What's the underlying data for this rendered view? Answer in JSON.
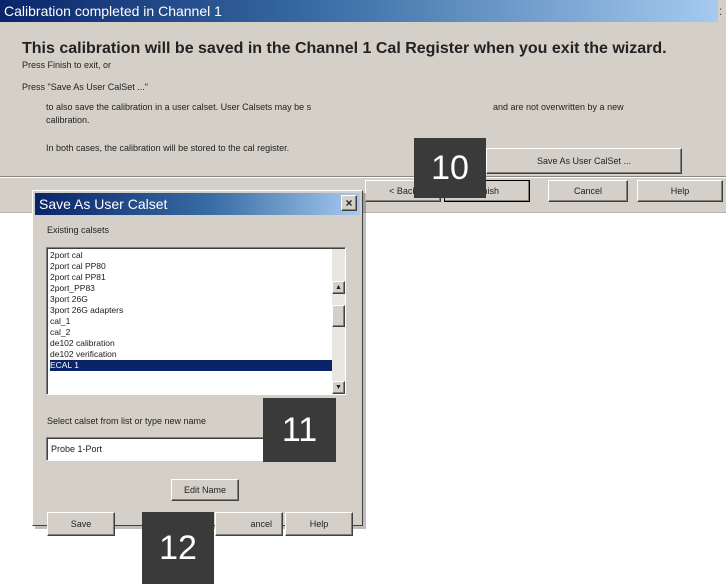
{
  "wizard": {
    "title": "Calibration completed in Channel 1",
    "headline": "This calibration will be saved in the Channel 1 Cal Register when you exit the wizard.",
    "line_finish": "Press Finish to exit, or",
    "line_saveas": "Press \"Save As User CalSet ...\"",
    "para_1a": "to also save the calibration in a user calset. User Calsets may be s",
    "para_1b": "and are not overwritten by a new",
    "para_1c": "calibration.",
    "para_2": "In both cases, the calibration will be stored to the cal register.",
    "save_as_button": "Save As User CalSet ...",
    "back_button": "< Back",
    "finish_button": "Finish",
    "cancel_button": "Cancel",
    "help_button": "Help"
  },
  "dialog": {
    "title": "Save As User Calset",
    "close_glyph": "×",
    "existing_label": "Existing calsets",
    "calsets": [
      "2port cal",
      "2port cal PP80",
      "2port cal PP81",
      "2port_PP83",
      "3port 26G",
      "3port 26G adapters",
      "cal_1",
      "cal_2",
      "de102 calibration",
      "de102 verification",
      "ECAL 1"
    ],
    "selected_calset": "ECAL 1",
    "select_label": "Select calset from list or type new name",
    "name_value": "Probe 1-Port",
    "edit_name_button": "Edit Name",
    "save_button": "Save",
    "cancel_button": "ancel",
    "help_button": "Help",
    "scroll_up_glyph": "▲",
    "scroll_down_glyph": "▼"
  },
  "callouts": [
    "10",
    "11",
    "12"
  ]
}
